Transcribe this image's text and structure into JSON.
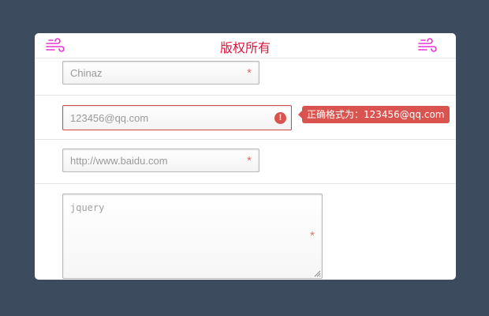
{
  "header": {
    "title": "版权所有",
    "left_icon": "wind-icon",
    "right_icon": "wind-icon",
    "accent_color": "#e0143c",
    "icon_color": "#e633d8"
  },
  "form": {
    "name_field": {
      "value": "Chinaz",
      "required_mark": "*"
    },
    "email_field": {
      "value": "123456@qq.com",
      "error_icon": "!",
      "tooltip": "正确格式为：123456@qq.com",
      "error_color": "#d9534f"
    },
    "url_field": {
      "value": "http://www.baidu.com",
      "required_mark": "*"
    },
    "message_field": {
      "value": "jquery",
      "required_mark": "*"
    }
  }
}
